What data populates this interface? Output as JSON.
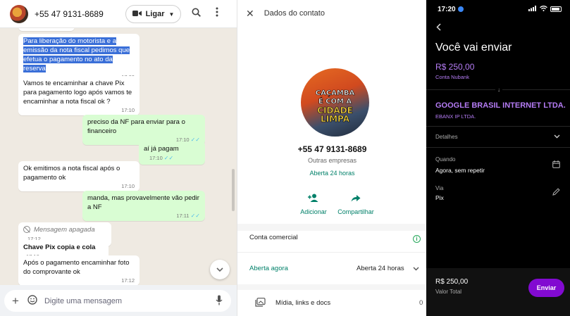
{
  "chat": {
    "contact_name": "+55 47 9131-8689",
    "call_label": "Ligar",
    "compose_placeholder": "Digite uma mensagem",
    "messages": [
      {
        "text": "17:09",
        "time": ""
      },
      {
        "text": "Para liberação do motorista e a emissão da nota fiscal pedimos que efetua o pagamento no ato da reserva",
        "time": "17:09"
      },
      {
        "text": "Vamos te encaminhar a chave Pix para pagamento logo após vamos te encaminhar a nota fiscal ok ?",
        "time": "17:10"
      },
      {
        "text": "preciso da NF para enviar para o financeiro",
        "time": "17:10"
      },
      {
        "text": "aí já pagam",
        "time": "17:10"
      },
      {
        "text": "Ok emitimos a nota fiscal após o pagamento ok",
        "time": "17:10"
      },
      {
        "text": "manda, mas provavelmente vão pedir a NF",
        "time": "17:11"
      },
      {
        "text": "Mensagem apagada",
        "time": "17:12"
      },
      {
        "text": "Chave Pix copia e cola",
        "time": "17:12"
      },
      {
        "text": "Após o pagamento encaminhar foto do comprovante ok",
        "time": "17:12"
      }
    ]
  },
  "contact": {
    "title": "Dados do contato",
    "logo_lines": [
      "CAÇAMBA",
      "É COM A",
      "CIDADE",
      "LIMPA"
    ],
    "phone": "+55 47 9131-8689",
    "category": "Outras empresas",
    "hours_short": "Aberta 24 horas",
    "actions": [
      {
        "label": "Adicionar"
      },
      {
        "label": "Compartilhar"
      }
    ],
    "business_account": "Conta comercial",
    "open_now": "Aberta agora",
    "open_hours": "Aberta 24 horas",
    "media_label": "Mídia, links e docs",
    "media_count": "0"
  },
  "nubank": {
    "time": "17:20",
    "heading": "Você vai enviar",
    "amount": "R$ 250,00",
    "account": "Conta Nubank",
    "recipient": "GOOGLE BRASIL INTERNET LTDA.",
    "recipient_sub": "EBANX IP LTDA.",
    "details": "Detalhes",
    "when_label": "Quando",
    "when_value": "Agora, sem repetir",
    "via_label": "Via",
    "via_value": "Pix",
    "total": "R$ 250,00",
    "total_label": "Valor Total",
    "send": "Enviar"
  }
}
